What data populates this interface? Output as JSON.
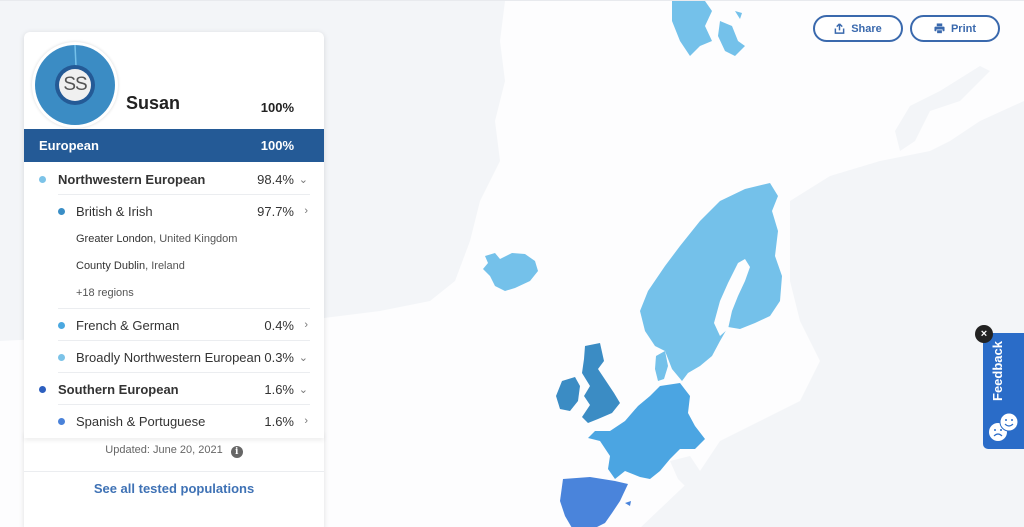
{
  "profile": {
    "initials": "SS",
    "name": "Susan",
    "total_percent": "100%"
  },
  "region": {
    "label": "European",
    "percent": "100%"
  },
  "breakdown": [
    {
      "label": "Northwestern European",
      "percent": "98.4%",
      "level": 1,
      "chevron": "down",
      "color": "#7cc3e8"
    },
    {
      "label": "British & Irish",
      "percent": "97.7%",
      "level": 2,
      "chevron": "right",
      "color": "#3a8ec6",
      "sub_regions": [
        {
          "place": "Greater London",
          "country": "United Kingdom"
        },
        {
          "place": "County Dublin",
          "country": "Ireland"
        }
      ],
      "more": "+18 regions"
    },
    {
      "label": "French & German",
      "percent": "0.4%",
      "level": 2,
      "chevron": "right",
      "color": "#4ba8e0"
    },
    {
      "label": "Broadly Northwestern European",
      "percent": "0.3%",
      "level": 2,
      "chevron": "down",
      "color": "#7cc3e8"
    },
    {
      "label": "Southern European",
      "percent": "1.6%",
      "level": 1,
      "chevron": "down",
      "color": "#2d5fbf"
    },
    {
      "label": "Spanish & Portuguese",
      "percent": "1.6%",
      "level": 2,
      "chevron": "right",
      "color": "#4a82d9"
    }
  ],
  "footer": {
    "updated": "Updated: June 20, 2021",
    "info_icon": "info-icon",
    "see_all": "See all tested populations"
  },
  "toolbar": {
    "share_label": "Share",
    "share_icon": "share-icon",
    "print_label": "Print",
    "print_icon": "print-icon"
  },
  "feedback": {
    "label": "Feedback",
    "close_glyph": "×",
    "icon": "feedback-faces-icon"
  },
  "map": {
    "colors": {
      "scandinavia": "#74c1ea",
      "british_irish": "#3b8cc4",
      "french_german": "#4ba5e2",
      "iberia": "#4a84db",
      "background_land": "#f3f5f8"
    }
  },
  "colors": {
    "accent": "#245a96",
    "link": "#3f72b5",
    "button": "#3a69ad",
    "feedback": "#2a6cc8"
  }
}
